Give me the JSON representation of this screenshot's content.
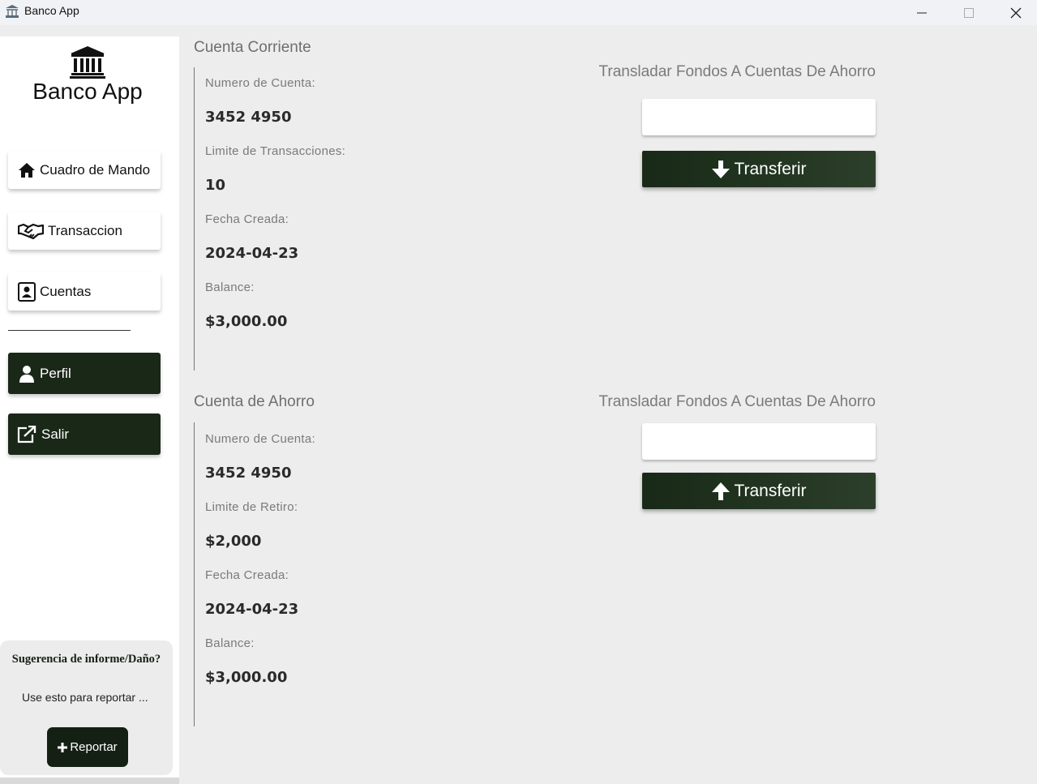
{
  "window": {
    "title": "Banco App"
  },
  "sidebar": {
    "brand": "Banco App",
    "nav": [
      {
        "label": "Cuadro de Mando",
        "icon": "home-icon"
      },
      {
        "label": "Transaccion",
        "icon": "handshake-icon"
      },
      {
        "label": "Cuentas",
        "icon": "contact-book-icon"
      }
    ],
    "actions": [
      {
        "label": "Perfil",
        "icon": "user-icon"
      },
      {
        "label": "Salir",
        "icon": "external-link-icon"
      }
    ],
    "report": {
      "title": "Sugerencia de informe/Daño?",
      "subtitle": "Use esto para reportar ...",
      "button_label": "Reportar"
    }
  },
  "checking": {
    "title": "Cuenta Corriente",
    "fields": [
      {
        "label": "Numero de Cuenta:",
        "value": "3452 4950"
      },
      {
        "label": "Limite de Transacciones:",
        "value": "10"
      },
      {
        "label": "Fecha Creada:",
        "value": "2024-04-23"
      },
      {
        "label": "Balance:",
        "value": "$3,000.00"
      }
    ],
    "transfer": {
      "heading": "Transladar Fondos A Cuentas De Ahorro",
      "input_value": "",
      "button_label": "Transferir",
      "button_icon": "arrow-down-icon"
    }
  },
  "savings": {
    "title": "Cuenta de Ahorro",
    "fields": [
      {
        "label": "Numero de Cuenta:",
        "value": "3452 4950"
      },
      {
        "label": "Limite de Retiro:",
        "value": "$2,000"
      },
      {
        "label": "Fecha Creada:",
        "value": "2024-04-23"
      },
      {
        "label": "Balance:",
        "value": "$3,000.00"
      }
    ],
    "transfer": {
      "heading": "Transladar Fondos A Cuentas De Ahorro",
      "input_value": "",
      "button_label": "Transferir",
      "button_icon": "arrow-up-icon"
    }
  },
  "colors": {
    "accent_dark": "#1a2818",
    "background": "#ededed",
    "sidebar": "#ffffff"
  }
}
